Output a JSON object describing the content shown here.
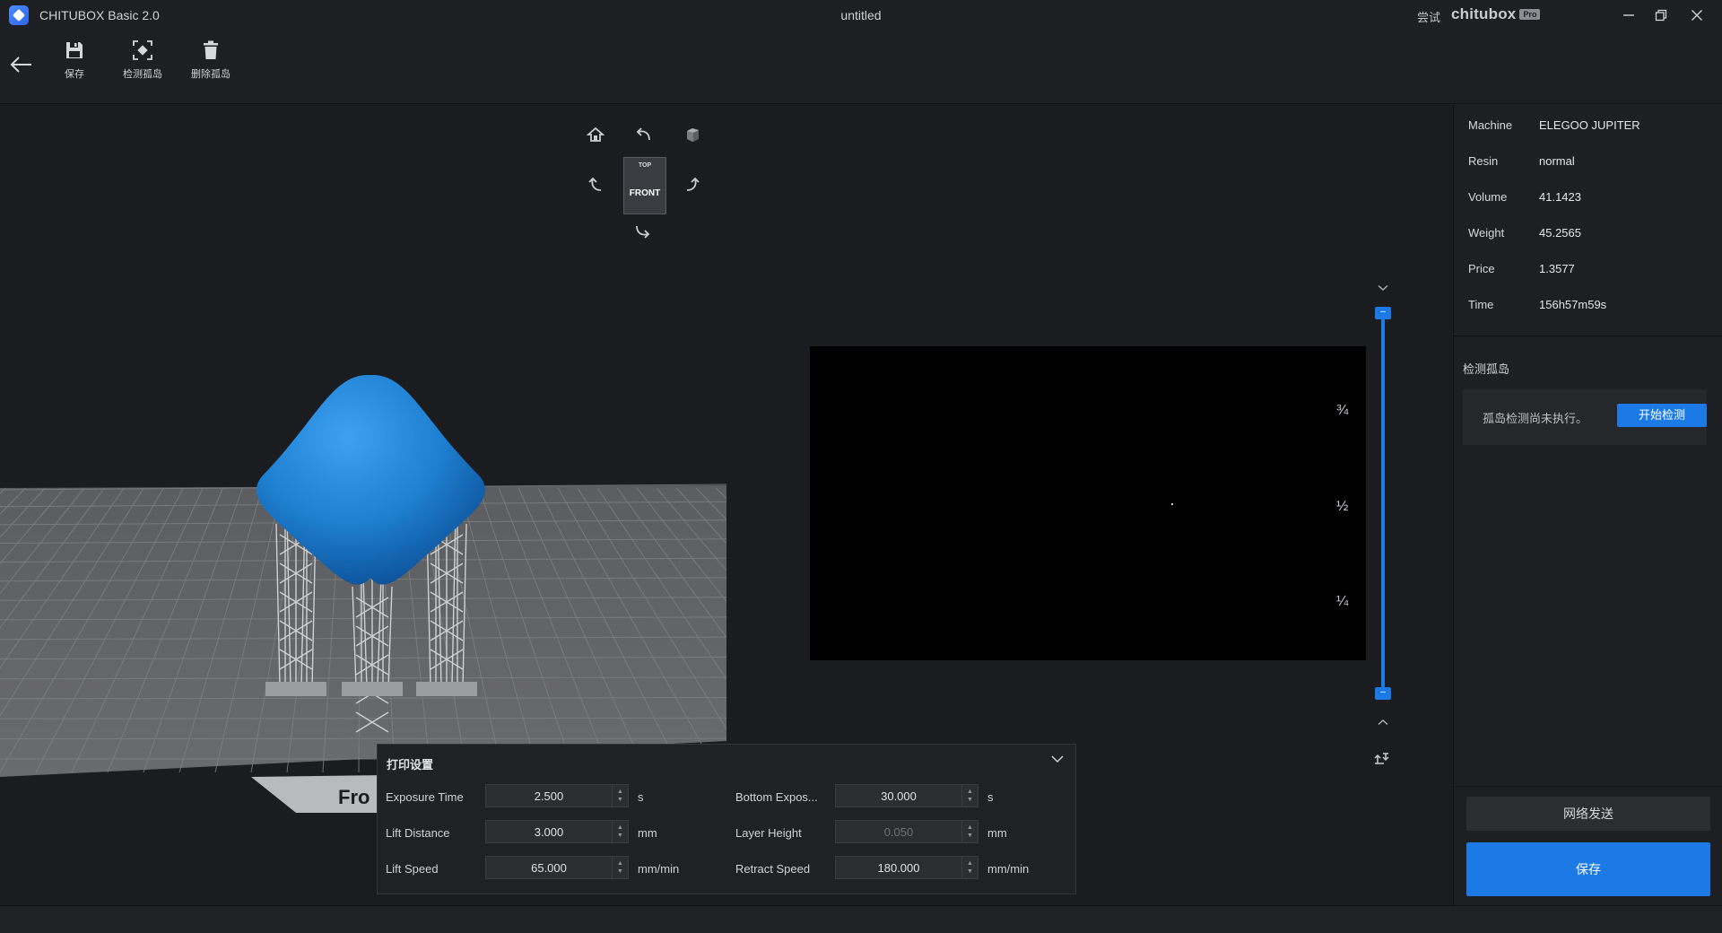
{
  "window": {
    "app_title": "CHITUBOX Basic 2.0",
    "doc_title": "untitled",
    "try_label": "尝试",
    "pro_brand": "chitubox",
    "pro_badge": "Pro"
  },
  "toolbar": {
    "save_label": "保存",
    "detect_label": "检测孤岛",
    "delete_label": "删除孤岛"
  },
  "viewport": {
    "cube_top": "TOP",
    "cube_front": "FRONT",
    "plate_label": "Fro"
  },
  "slice_preview": {
    "fractions": [
      "¾",
      "½",
      "¼"
    ]
  },
  "print_settings": {
    "title": "打印设置",
    "fields": [
      {
        "label": "Exposure Time",
        "value": "2.500",
        "unit": "s",
        "disabled": false
      },
      {
        "label": "Lift Distance",
        "value": "3.000",
        "unit": "mm",
        "disabled": false
      },
      {
        "label": "Lift Speed",
        "value": "65.000",
        "unit": "mm/min",
        "disabled": false
      },
      {
        "label": "Bottom Expos...",
        "value": "30.000",
        "unit": "s",
        "disabled": false
      },
      {
        "label": "Layer Height",
        "value": "0.050",
        "unit": "mm",
        "disabled": true
      },
      {
        "label": "Retract Speed",
        "value": "180.000",
        "unit": "mm/min",
        "disabled": false
      }
    ]
  },
  "info": {
    "rows": [
      {
        "key": "Machine",
        "value": "ELEGOO JUPITER"
      },
      {
        "key": "Resin",
        "value": "normal"
      },
      {
        "key": "Volume",
        "value": "41.1423"
      },
      {
        "key": "Weight",
        "value": "45.2565"
      },
      {
        "key": "Price",
        "value": "1.3577"
      },
      {
        "key": "Time",
        "value": "156h57m59s"
      }
    ],
    "island_title": "检测孤岛",
    "island_message": "孤岛检测尚未执行。",
    "start_button": "开始检测",
    "network_button": "网络发送",
    "save_button": "保存"
  },
  "colors": {
    "accent": "#1b7ae6",
    "model": "#1e7fd0",
    "background": "#1b1c1f"
  }
}
